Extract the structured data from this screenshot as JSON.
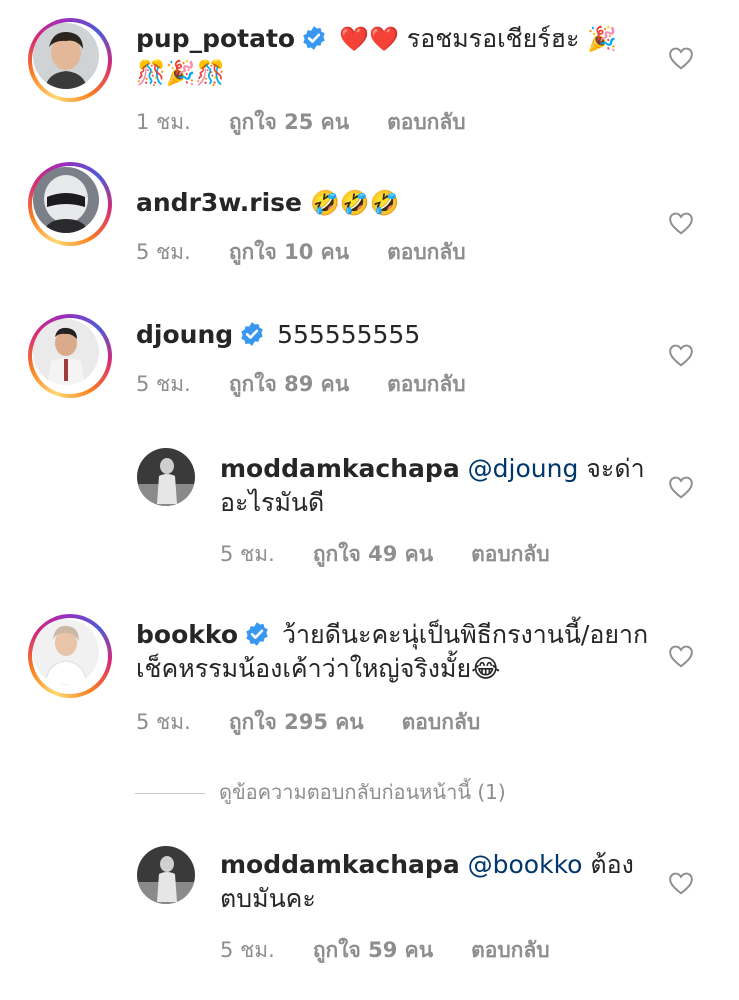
{
  "comments": [
    {
      "username": "pup_potato",
      "verified": true,
      "text": "รอชมรอเชียร์ฮะ",
      "emoji_prefix": "❤️❤️",
      "emoji_suffix": "🎉🎊🎉🎊",
      "time": "1 ชม.",
      "likes": "ถูกใจ 25 คน",
      "reply": "ตอบกลับ"
    },
    {
      "username": "andr3w.rise",
      "verified": false,
      "text": "🤣🤣🤣",
      "time": "5 ชม.",
      "likes": "ถูกใจ 10 คน",
      "reply": "ตอบกลับ"
    },
    {
      "username": "djoung",
      "verified": true,
      "text": "555555555",
      "time": "5 ชม.",
      "likes": "ถูกใจ 89 คน",
      "reply": "ตอบกลับ"
    },
    {
      "username": "moddamkachapa",
      "mention": "@djoung",
      "text": "จะด่าอะไรมันดี",
      "time": "5 ชม.",
      "likes": "ถูกใจ 49 คน",
      "reply": "ตอบกลับ"
    },
    {
      "username": "bookko",
      "verified": true,
      "text": "ว้ายดีนะคะนุ่เป็นพิธีกรงานนี้/อยากเช็คหรรมน้องเค้าว่าใหญ่จริงมั้ย😂",
      "time": "5 ชม.",
      "likes": "ถูกใจ 295 คน",
      "reply": "ตอบกลับ"
    },
    {
      "username": "moddamkachapa",
      "mention": "@bookko",
      "text": "ต้องตบมันคะ",
      "time": "5 ชม.",
      "likes": "ถูกใจ 59 คน",
      "reply": "ตอบกลับ"
    }
  ],
  "view_previous_replies": "ดูข้อความตอบกลับก่อนหน้านี้ (1)",
  "icons": {
    "verified": "verified-badge-icon",
    "like": "heart-outline-icon"
  },
  "colors": {
    "verified_blue": "#3897f0",
    "mention": "#00376b",
    "meta_grey": "#8e8e8e"
  }
}
